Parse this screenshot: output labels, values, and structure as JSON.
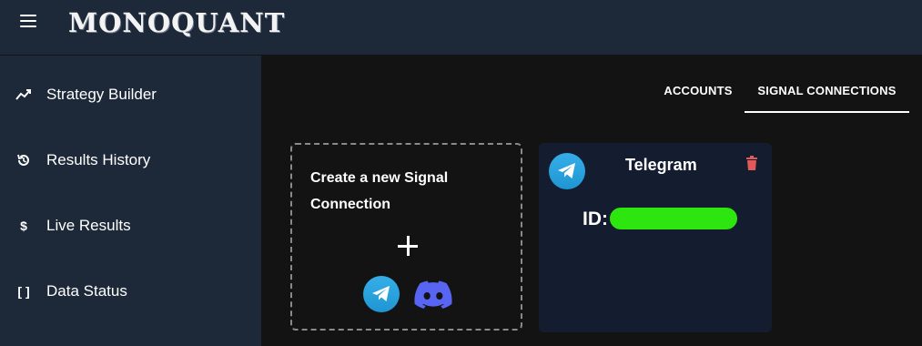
{
  "app": {
    "logo_text": "MONOQUANT",
    "menu_icon": "hamburger-menu-icon"
  },
  "sidebar": {
    "items": [
      {
        "label": "Strategy Builder",
        "icon": "trending-chart-icon"
      },
      {
        "label": "Results History",
        "icon": "history-icon"
      },
      {
        "label": "Live Results",
        "icon": "dollar-icon"
      },
      {
        "label": "Data Status",
        "icon": "brackets-icon"
      }
    ]
  },
  "tabs": [
    {
      "label": "ACCOUNTS",
      "active": false
    },
    {
      "label": "SIGNAL CONNECTIONS",
      "active": true
    }
  ],
  "create_card": {
    "title": "Create a new Signal Connection",
    "add_icon": "plus-icon",
    "providers": [
      "telegram-icon",
      "discord-icon"
    ]
  },
  "connections": [
    {
      "name": "Telegram",
      "id_label": "ID:",
      "id_value": "",
      "icon": "telegram-icon",
      "delete_icon": "trash-icon"
    }
  ],
  "colors": {
    "sidebar_bg": "#1d2839",
    "main_bg": "#131313",
    "card_bg": "#141c2f",
    "telegram_blue": "#2ca5e0",
    "discord_purple": "#5865f2",
    "delete_red": "#e05a5a",
    "redaction_green": "#2ee60f"
  }
}
